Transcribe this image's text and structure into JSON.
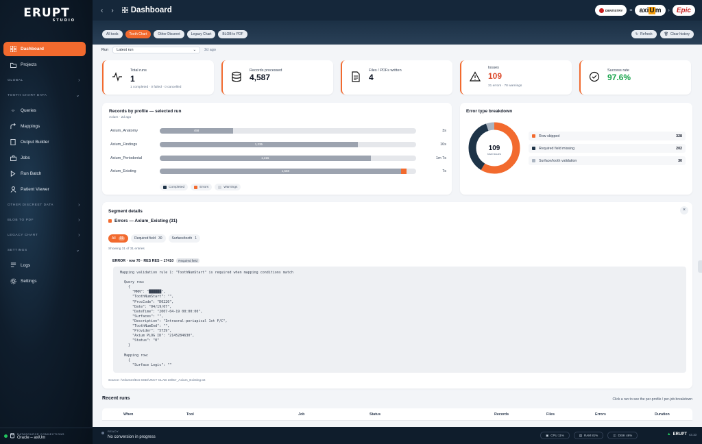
{
  "app": {
    "logo": "ERUPT",
    "logo_sub": "STUDIO",
    "page_title": "Dashboard"
  },
  "sidebar": {
    "dashboard": "Dashboard",
    "projects": "Projects",
    "sections": {
      "global": "Global",
      "tooth_chart_data": "Tooth chart data",
      "other_discreet_data": "Other discreet data",
      "blob_to_pdf": "Blob to PDF",
      "legacy_chart": "Legacy chart",
      "settings": "Settings"
    },
    "items": [
      "Queries",
      "Mappings",
      "Output Builder",
      "Jobs",
      "Run Batch",
      "Patient Viewer"
    ],
    "settings_items": [
      "Logs",
      "Settings"
    ],
    "datasource_label": "Datasource connections",
    "datasource_value": "Oracle – axiUm"
  },
  "header": {
    "brands": {
      "dentistry": "DENTISTRY",
      "axium_pre": "axi",
      "axium_mid": "U",
      "axium_post": "m",
      "epic": "Epic"
    }
  },
  "tabs": [
    "All tools",
    "Tooth Chart",
    "Other Discreet",
    "Legacy Chart",
    "BLOB to PDF"
  ],
  "toolbar": {
    "refresh": "Refresh",
    "clear_history": "Clear history"
  },
  "run": {
    "label": "Run",
    "value": "Latest run",
    "ago": "2d ago"
  },
  "kpis": {
    "total_runs": {
      "label": "Total runs",
      "value": "1",
      "sub": "1 completed · 0 failed · 0 cancelled"
    },
    "records": {
      "label": "Records processed",
      "value": "4,587"
    },
    "files": {
      "label": "Files / PDFs written",
      "value": "4"
    },
    "issues": {
      "label": "Issues",
      "value": "109",
      "sub": "31 errors · 78 warnings"
    },
    "success": {
      "label": "Success rate",
      "value": "97.6%"
    }
  },
  "records_by_profile": {
    "title": "Records by profile — selected run",
    "meta": "Axium · 2d ago",
    "legend": [
      "Completed",
      "Errors",
      "Warnings"
    ]
  },
  "chart_data": {
    "type": "bar",
    "title": "Records by profile — selected run",
    "categories": [
      "Axium_Anatomy",
      "Axium_Findings",
      "Axium_Periodontal",
      "Axium_Existing"
    ],
    "series": [
      {
        "name": "Completed",
        "values": [
          458,
          1235,
          1315,
          1568
        ]
      },
      {
        "name": "Errors",
        "values": [
          0,
          0,
          0,
          31
        ]
      }
    ],
    "value_labels": [
      "458",
      "1,235",
      "1,315",
      "1,568"
    ],
    "durations": [
      "3s",
      "10s",
      "1m 7s",
      "7s"
    ],
    "orientation": "horizontal"
  },
  "error_breakdown": {
    "title": "Error type breakdown",
    "total": "109",
    "total_label": "total issues",
    "items": [
      {
        "label": "Row skipped",
        "count": "328",
        "value": 328,
        "color": "#f26a2e"
      },
      {
        "label": "Required field missing",
        "count": "202",
        "value": 202,
        "color": "#1e3448"
      },
      {
        "label": "Surface/tooth validation",
        "count": "30",
        "value": 30,
        "color": "#aab4c0"
      }
    ]
  },
  "segment": {
    "title": "Segment details",
    "subtitle": "Errors — Axium_Existing (31)",
    "chips": [
      {
        "label": "All",
        "count": "31"
      },
      {
        "label": "Required field",
        "count": "30"
      },
      {
        "label": "Surface/tooth",
        "count": "1"
      }
    ],
    "showing": "Showing 31 of 31 entries",
    "error_title": "ERROR · row 70 · RES RES – 17410",
    "error_badge": "Required field",
    "code": "Mapping validation rule 1: \"ToothNumStart\" is required when mapping conditions match\n\n  Query row:\n    {\n      \"MRN\": \"██████\",\n      \"ToothNumStart\": \"\",\n      \"ProcCode\": \"D0220\",\n      \"Date\": \"04/19/07\",\n      \"DateTime\": \"2007-04-19 00:00:00\",\n      \"Surfaces\": \"\",\n      \"Description\": \"Intraoral-periapical 1st F/C\",\n      \"ToothNumEnd\": \"\",\n      \"Provider\": \"5739\",\n      \"Axium PLOG ID\": \"2145284630\",\n      \"Status\": \"0\"\n    }\n\n  Mapping row:\n    {\n      \"Surface Logic\": \"\"",
    "source": "Source: /Volumes/Ext SSD/UKCT CLAB 18/Err_Axium_Existing.txt"
  },
  "recent_runs": {
    "title": "Recent runs",
    "hint": "Click a run to see the per-profile / per-job breakdown",
    "columns": [
      "When",
      "Tool",
      "Job",
      "Status",
      "Records",
      "Files",
      "Errors",
      "Duration"
    ]
  },
  "statusbar": {
    "state_label": "Ready",
    "state_text": "No conversion in progress",
    "cpu": "CPU 11%",
    "ram": "RAM 81%",
    "disk": "DISK 46%",
    "app": "ERUPT",
    "version": "v3.10"
  }
}
